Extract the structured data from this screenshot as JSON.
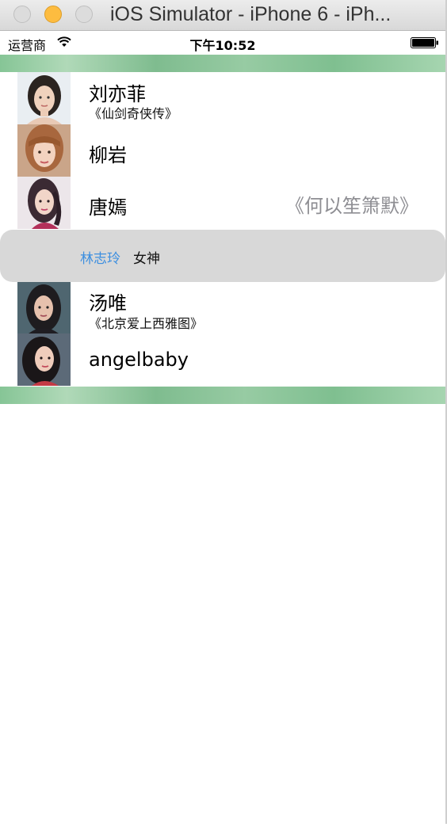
{
  "window": {
    "title": "iOS Simulator - iPhone 6 - iPh..."
  },
  "status_bar": {
    "carrier": "运营商",
    "time": "下午10:52"
  },
  "rows": [
    {
      "name": "刘亦菲",
      "subtitle": "《仙剑奇侠传》",
      "detail": ""
    },
    {
      "name": "柳岩",
      "subtitle": "",
      "detail": ""
    },
    {
      "name": "唐嫣",
      "subtitle": "",
      "detail": "《何以笙箫默》"
    },
    {
      "name": "汤唯",
      "subtitle": "《北京爱上西雅图》",
      "detail": ""
    },
    {
      "name": "angelbaby",
      "subtitle": "",
      "detail": ""
    }
  ],
  "floating_cell": {
    "name": "林志玲",
    "subtitle": "女神"
  },
  "colors": {
    "header_bar": "#86c596",
    "floating_cell_bg": "#d8d8d8",
    "floating_name": "#3d8fe0",
    "detail_text": "#8e8e93"
  }
}
